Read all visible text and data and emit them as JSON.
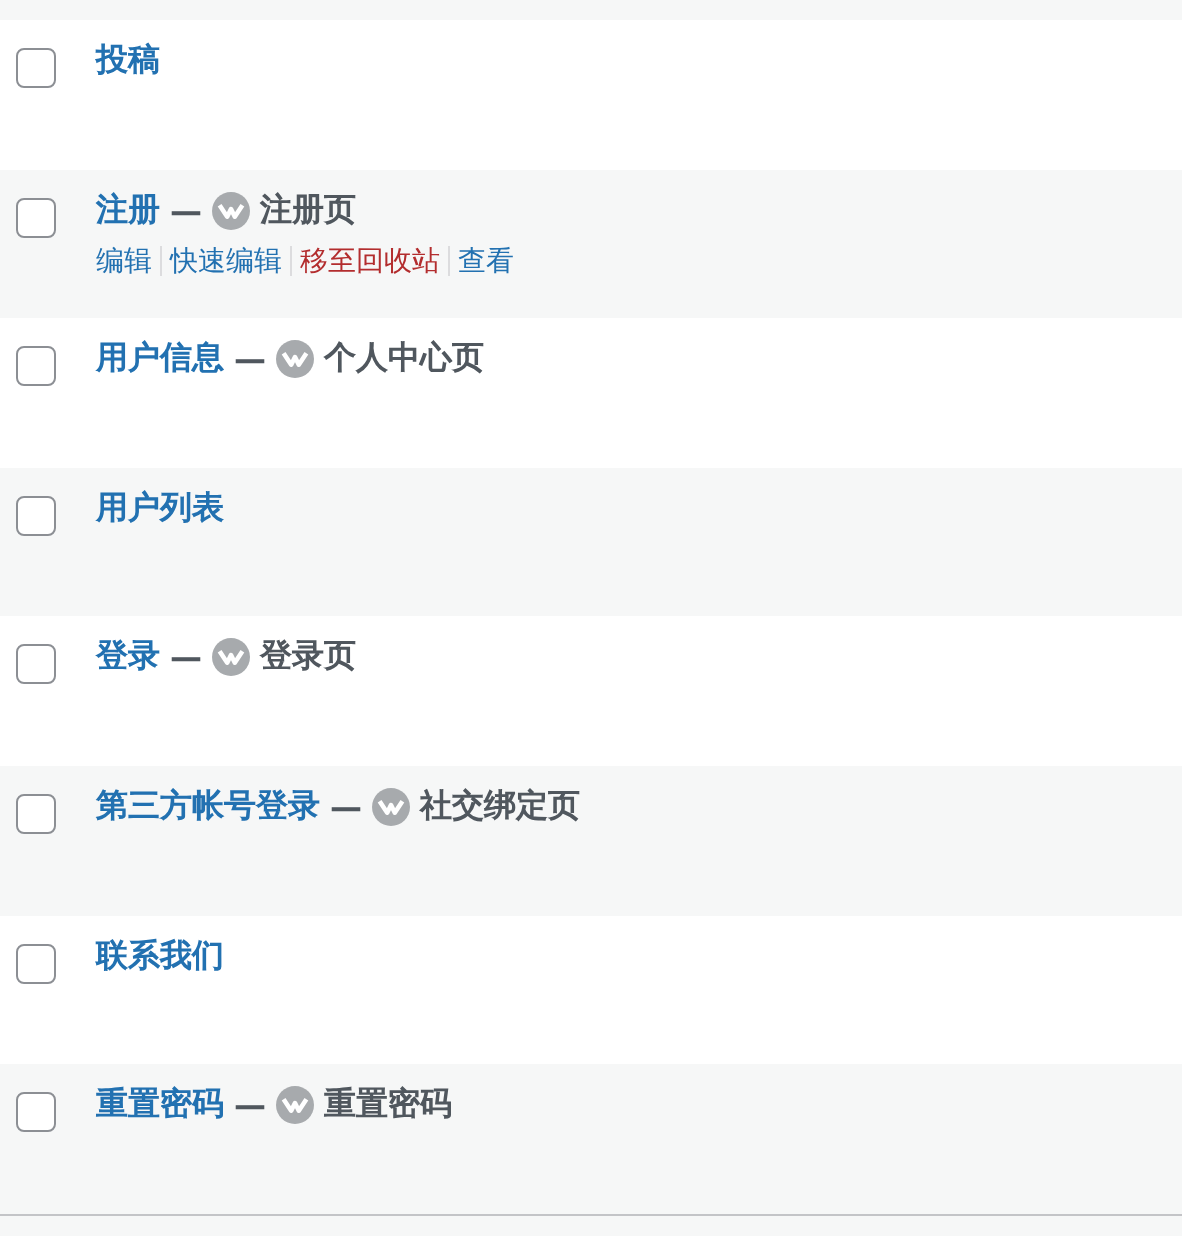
{
  "rows": [
    {
      "title": "投稿",
      "checked": false
    },
    {
      "title": "注册",
      "checked": false,
      "separator": "—",
      "post_state": "注册页",
      "actions": [
        {
          "label": "编辑",
          "kind": "link"
        },
        {
          "label": "快速编辑",
          "kind": "link"
        },
        {
          "label": "移至回收站",
          "kind": "delete"
        },
        {
          "label": "查看",
          "kind": "link"
        }
      ]
    },
    {
      "title": "用户信息",
      "checked": false,
      "separator": "—",
      "post_state": "个人中心页"
    },
    {
      "title": "用户列表",
      "checked": false
    },
    {
      "title": "登录",
      "checked": false,
      "separator": "—",
      "post_state": "登录页"
    },
    {
      "title": "第三方帐号登录",
      "checked": false,
      "separator": "—",
      "post_state": "社交绑定页"
    },
    {
      "title": "联系我们",
      "checked": false
    },
    {
      "title": "重置密码",
      "checked": false,
      "separator": "—",
      "post_state": "重置密码"
    }
  ]
}
